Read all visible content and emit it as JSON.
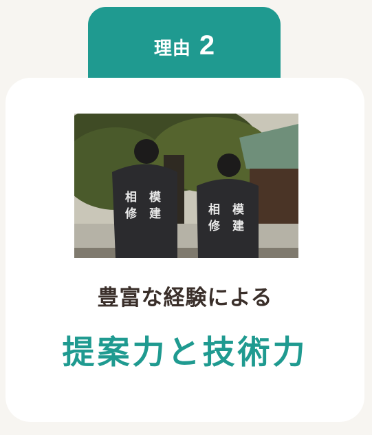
{
  "reason": {
    "label": "理由",
    "number": "2"
  },
  "card": {
    "subtitle": "豊富な経験による",
    "title": "提案力と技術力"
  },
  "photo": {
    "shirt_text_left": "相 模 修 建",
    "shirt_text_right": "相 模 修 建",
    "colors": {
      "accent": "#1f9a90",
      "text_dark": "#3a2f2a",
      "background": "#f7f5f1"
    }
  }
}
